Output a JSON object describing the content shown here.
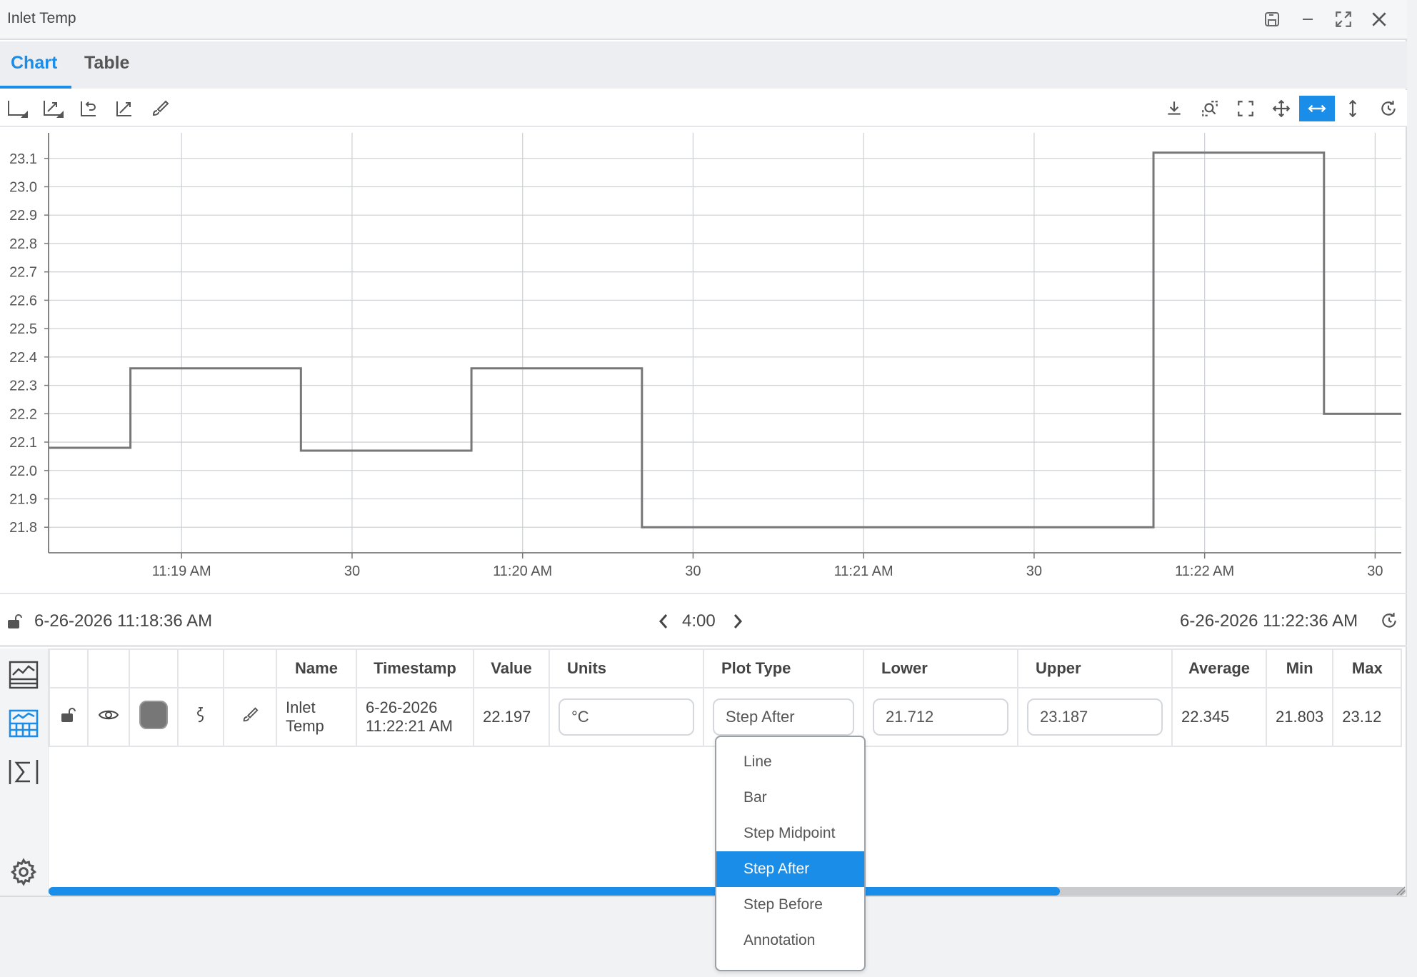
{
  "window": {
    "title": "Inlet Temp",
    "controls": [
      "save-icon",
      "minimize-icon",
      "maximize-icon",
      "close-icon"
    ]
  },
  "tabs": [
    {
      "label": "Chart",
      "active": true
    },
    {
      "label": "Table",
      "active": false
    }
  ],
  "toolbar": {
    "left": [
      "axis-autoscale-icon",
      "axis-expand-icon",
      "undo-zoom-icon",
      "trend-icon",
      "brush-icon"
    ],
    "right": [
      "download-icon",
      "zoom-box-icon",
      "fit-screen-icon",
      "pan-icon",
      "horizontal-zoom-icon",
      "vertical-zoom-icon",
      "reset-icon"
    ],
    "active": "horizontal-zoom-icon",
    "accent": "#1a8de9"
  },
  "chart_data": {
    "type": "line",
    "step": "after",
    "y_ticks": [
      "21.8",
      "21.9",
      "22.0",
      "22.1",
      "22.2",
      "22.3",
      "22.4",
      "22.5",
      "22.6",
      "22.7",
      "22.8",
      "22.9",
      "23.0",
      "23.1"
    ],
    "ylim": [
      21.71,
      23.19
    ],
    "x_ticks": [
      {
        "t": 1140,
        "label": "11:19 AM"
      },
      {
        "t": 1170,
        "label": "30"
      },
      {
        "t": 1200,
        "label": "11:20 AM"
      },
      {
        "t": 1230,
        "label": "30"
      },
      {
        "t": 1260,
        "label": "11:21 AM"
      },
      {
        "t": 1290,
        "label": "30"
      },
      {
        "t": 1320,
        "label": "11:22 AM"
      },
      {
        "t": 1350,
        "label": "30"
      }
    ],
    "xlim": [
      1116.6,
      1354.6
    ],
    "series": [
      {
        "color": "#777777",
        "x": [
          1116.6,
          1131,
          1161,
          1191,
          1221,
          1311,
          1341,
          1354.6
        ],
        "y": [
          22.08,
          22.36,
          22.07,
          22.36,
          21.8,
          23.12,
          22.2,
          22.2
        ]
      }
    ],
    "grid": true,
    "legend": "none"
  },
  "range": {
    "start": "6-26-2026 11:18:36 AM",
    "duration": "4:00",
    "end": "6-26-2026 11:22:36 AM"
  },
  "sidebar": [
    "chart-panel-icon",
    "table-panel-icon",
    "sigma-icon",
    "settings-icon"
  ],
  "table": {
    "headers": [
      "",
      "",
      "",
      "",
      "",
      "Name",
      "Timestamp",
      "Value",
      "Units",
      "Plot Type",
      "Lower",
      "Upper",
      "Average",
      "Min",
      "Max"
    ],
    "row": {
      "name_line1": "Inlet",
      "name_line2": "Temp",
      "timestamp_line1": "6-26-2026",
      "timestamp_line2": "11:22:21 AM",
      "value": "22.197",
      "units": "°C",
      "plot_type": "Step After",
      "lower": "21.712",
      "upper": "23.187",
      "average": "22.345",
      "min": "21.803",
      "max": "23.12",
      "swatch_color": "#777777"
    }
  },
  "dropdown": {
    "options": [
      "Line",
      "Bar",
      "Step Midpoint",
      "Step After",
      "Step Before",
      "Annotation"
    ],
    "selected_index": 3
  },
  "scrollbar": {
    "position_fraction": 0.745
  }
}
